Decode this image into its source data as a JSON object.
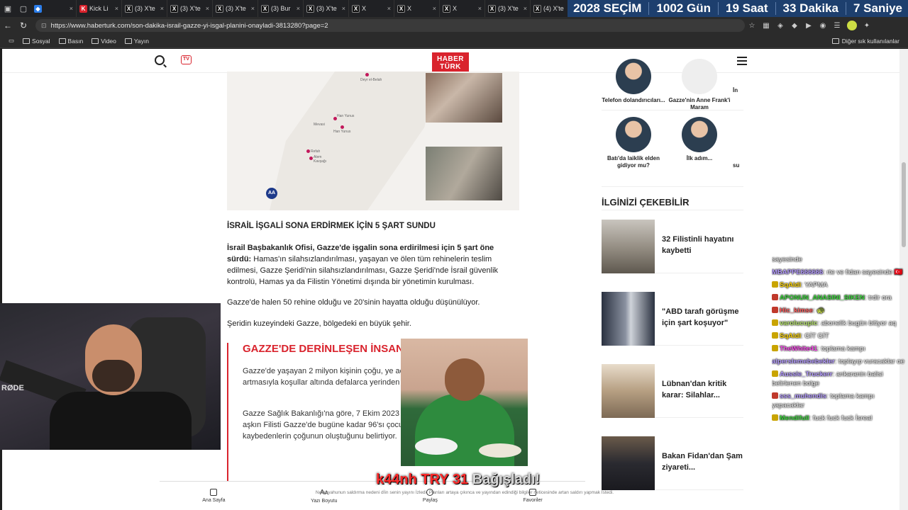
{
  "browser": {
    "tabs": [
      {
        "label": "",
        "icon": "bluesky-icon"
      },
      {
        "label": "Kick Li",
        "icon": "kick-icon"
      },
      {
        "label": "(3) X'te",
        "icon": "x-icon"
      },
      {
        "label": "(3) X'te",
        "icon": "x-icon"
      },
      {
        "label": "(3) X'te",
        "icon": "x-icon"
      },
      {
        "label": "(3) Bur",
        "icon": "x-icon"
      },
      {
        "label": "(3) X'te",
        "icon": "x-icon"
      },
      {
        "label": "X",
        "icon": "x-icon"
      },
      {
        "label": "X",
        "icon": "x-icon"
      },
      {
        "label": "X",
        "icon": "x-icon"
      },
      {
        "label": "(3) X'te",
        "icon": "x-icon"
      },
      {
        "label": "(4) X'te",
        "icon": "x-icon"
      }
    ],
    "url": "https://www.haberturk.com/son-dakika-israil-gazze-yi-isgal-planini-onayladi-3813280?page=2",
    "bookmarks": [
      "Sosyal",
      "Basın",
      "Video",
      "Yayın"
    ],
    "bookmarks_other": "Diğer sık kullanılanlar"
  },
  "election": {
    "title": "2028 SEÇİM",
    "days": "1002 Gün",
    "hours": "19 Saat",
    "minutes": "33 Dakika",
    "seconds": "7 Saniye"
  },
  "site": {
    "logo_line1": "HABER",
    "logo_line2": "TÜRK",
    "tv_label": "TV"
  },
  "map": {
    "places": [
      "Deyr el-Belah",
      "Han Yunus",
      "Mevasi",
      "Han Yunus",
      "Refah",
      "Alem",
      "Kavşağı"
    ],
    "source": "AA"
  },
  "article": {
    "heading": "İSRAİL İŞGALİ SONA ERDİRMEK İÇİN 5 ŞART SUNDU",
    "p1_bold": "İsrail Başbakanlık Ofisi, Gazze'de işgalin sona erdirilmesi için 5 şart öne sürdü:",
    "p1_rest": " Hamas'ın silahsızlandırılması, yaşayan ve ölen tüm rehinelerin teslim edilmesi, Gazze Şeridi'nin silahsızlandırılması, Gazze Şeridi'nde İsrail güvenlik kontrolü, Hamas ya da Filistin Yönetimi dışında bir yönetimin kurulması.",
    "p2": "Gazze'de halen 50 rehine olduğu ve 20'sinin hayatta olduğu düşünülüyor.",
    "p3": "Şeridin kuzeyindeki Gazze, bölgedeki en büyük şehir.",
    "quote_heading": "GAZZE'DE DERİNLEŞEN İNSAN",
    "quote_p1": "Gazze'de yaşayan 2 milyon kişinin çoğu, ye açlıktan kaynaklanan ölümlerin artmasıyla koşullar altında defalarca yerinden edildi.",
    "quote_p2": "Gazze Sağlık Bakanlığı'na göre, 7 Ekim 2023 başlangıcından bu yana 61 bini aşkın Filisti Gazze'de bugüne kadar 96'sı çocuk 197 kişi Yetkililer, hayatını kaybedenlerin çoğunun oluştuğunu belirtiyor."
  },
  "sidebar": {
    "topics": [
      {
        "label": "Telefon dolandırıcıları..."
      },
      {
        "label": "Gazze'nin Anne Frank'i Maram"
      },
      {
        "label": "İn"
      },
      {
        "label": "Batı'da laiklik elden gidiyor mu?"
      },
      {
        "label": "İlk adım..."
      },
      {
        "label": "su"
      }
    ],
    "heading": "İLGİNİZİ ÇEKEBİLİR",
    "cards": [
      {
        "title": "32 Filistinli hayatını kaybetti"
      },
      {
        "title": "\"ABD tarafı görüşme için şart koşuyor\""
      },
      {
        "title": "Lübnan'dan kritik karar: Silahlar..."
      },
      {
        "title": "Bakan Fidan'dan Şam ziyareti..."
      }
    ]
  },
  "bottom_nav": [
    {
      "label": "Ana Sayfa",
      "icon": "home-icon"
    },
    {
      "label": "Yazı Boyutu",
      "icon": "font-size-icon"
    },
    {
      "label": "Paylaş",
      "icon": "share-icon"
    },
    {
      "label": "Favoriler",
      "icon": "bookmark-icon"
    }
  ],
  "webcam": {
    "mic_brand": "RØDE"
  },
  "chat": [
    {
      "user": "",
      "text": "sayesinde",
      "color": "#9ad",
      "badge": ""
    },
    {
      "user": "MBAPPE666666",
      "text": ": rte ve fidan sayesinde 🇹🇷",
      "color": "#b59cff",
      "badge": ""
    },
    {
      "user": "SqAldi",
      "text": ": YAPMA",
      "color": "#ffd500",
      "badge": "#c9a400"
    },
    {
      "user": "APONUN_ANASINI_SIKEN",
      "text": ": trdir ora",
      "color": "#3cd63c",
      "badge": "#c0392b"
    },
    {
      "user": "Hic_kimse",
      "text": ": 🐢",
      "color": "#ff5c5c",
      "badge": "#c0392b"
    },
    {
      "user": "varolucupic",
      "text": ": abonelik bugün bitiyor aq",
      "color": "#b5e36b",
      "badge": "#c9a400"
    },
    {
      "user": "SqAldi",
      "text": ": GİT GİT",
      "color": "#ffd500",
      "badge": "#c9a400"
    },
    {
      "user": "TheWhite41",
      "text": ": toplama kampı",
      "color": "#ff4df0",
      "badge": "#c9a400"
    },
    {
      "user": "alperslemebebekler",
      "text": ": toplayıp vuracaklar oe",
      "color": "#b59cff",
      "badge": ""
    },
    {
      "user": "Aussie_Truckerr",
      "text": ": ankaranin balisi belirlenen bolge",
      "color": "#b59cff",
      "badge": "#c9a400"
    },
    {
      "user": "sss_muhendis",
      "text": ": toplama kampı yapacaklar",
      "color": "#b59cff",
      "badge": "#c0392b"
    },
    {
      "user": "Mendifull",
      "text": ": fuck fuck fuck İsreal",
      "color": "#3cd63c",
      "badge": "#c9a400"
    }
  ],
  "donation": {
    "red": "k44nh TRY 31",
    "gray": "Bağışladı!",
    "sub": "Netanyahunun saldırma nedeni dİin senin yayını İzledi. Planları artaya çıkınca ve yayından edindiği bilgiler neticesinde artan saldırı yapmak İstedi."
  },
  "colors": {
    "brand_red": "#d9232d",
    "election_blue": "#1d3f6e"
  }
}
